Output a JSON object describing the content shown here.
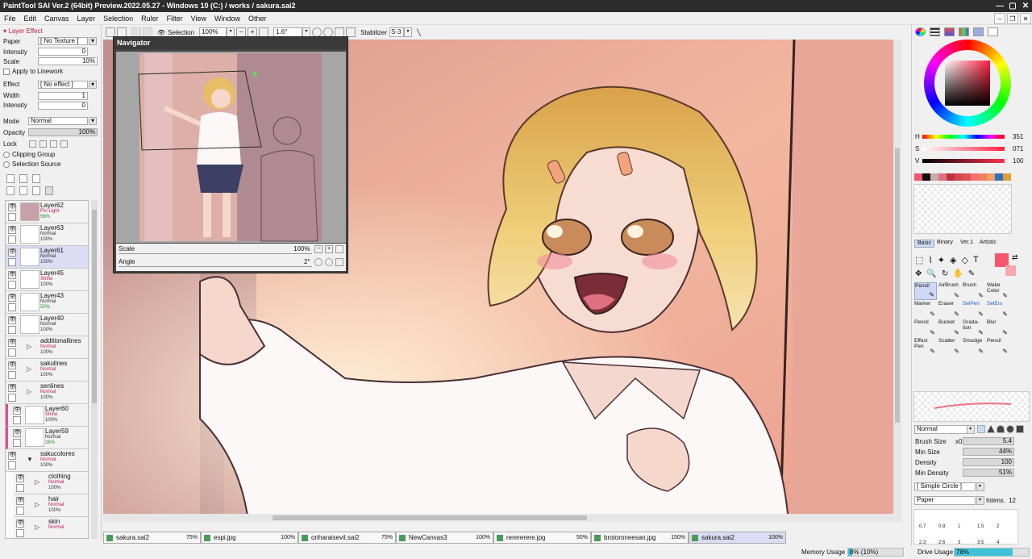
{
  "title_bar": {
    "text": "PaintTool SAI Ver.2 (64bit) Preview.2022.05.27 - Windows 10 (C:) / works / sakura.sai2"
  },
  "menu": [
    "File",
    "Edit",
    "Canvas",
    "Layer",
    "Selection",
    "Ruler",
    "Filter",
    "View",
    "Window",
    "Other"
  ],
  "layer_effect": {
    "header": "Layer Effect",
    "paper_label": "Paper",
    "paper_value": "[ No Texture ]",
    "intensity_label": "Intensity",
    "intensity_value": "0",
    "scale_label": "Scale",
    "scale_value": "10%",
    "apply_linework": "Apply to Linework",
    "effect_label": "Effect",
    "effect_value": "[ No effect ]",
    "width_label": "Width",
    "width_value": "1",
    "intensity2_label": "Intensity",
    "intensity2_value": "0"
  },
  "layer_props": {
    "mode_label": "Mode",
    "mode_value": "Normal",
    "opacity_label": "Opacity",
    "opacity_value": "100%",
    "lock_label": "Lock",
    "clipping_group": "Clipping Group",
    "selection_source": "Selection Source"
  },
  "layers": [
    {
      "name": "Layer62",
      "mode": "Pin Light",
      "opacity": "56%",
      "op_green": true
    },
    {
      "name": "Layer63",
      "mode": "Normal",
      "opacity": "100%"
    },
    {
      "name": "Layer61",
      "mode": "Normal",
      "opacity": "100%",
      "selected": true
    },
    {
      "name": "Layer45",
      "mode": "Shine",
      "opacity": "100%"
    },
    {
      "name": "Layer43",
      "mode": "Normal",
      "opacity": "52%",
      "op_green": true
    },
    {
      "name": "Layer40",
      "mode": "Normal",
      "opacity": "100%"
    },
    {
      "name": "additionallines",
      "mode": "Normal",
      "opacity": "100%",
      "folder": true
    },
    {
      "name": "sakulines",
      "mode": "Normal",
      "opacity": "100%",
      "folder": true
    },
    {
      "name": "senlines",
      "mode": "Normal",
      "opacity": "100%",
      "folder": true
    },
    {
      "name": "Layer60",
      "mode": "Shine",
      "opacity": "100%",
      "clip": true
    },
    {
      "name": "Layer59",
      "mode": "Normal",
      "opacity": "26%",
      "op_green": true,
      "clip": true
    },
    {
      "name": "sakucolores",
      "mode": "Normal",
      "opacity": "100%",
      "folder": true,
      "open": true
    },
    {
      "name": "clothing",
      "mode": "Normal",
      "opacity": "100%",
      "folder": true,
      "indent": true
    },
    {
      "name": "hair",
      "mode": "Normal",
      "opacity": "100%",
      "folder": true,
      "indent": true
    },
    {
      "name": "skin",
      "mode": "Normal",
      "opacity": "",
      "folder": true,
      "indent": true
    }
  ],
  "toolbar": {
    "selection_label": "Selection",
    "zoom": "100%",
    "angle": "1.6°",
    "stabilizer_label": "Stabilizer",
    "stabilizer_value": "S-3"
  },
  "navigator": {
    "title": "Navigator",
    "scale_label": "Scale",
    "scale_value": "100%",
    "angle_label": "Angle",
    "angle_value": "2°"
  },
  "tabs": [
    {
      "name": "sakura.sai2",
      "pct": "75%"
    },
    {
      "name": "espi.jpg",
      "pct": "100%"
    },
    {
      "name": "oriharaisevil.sai2",
      "pct": "75%"
    },
    {
      "name": "NewCanvas3",
      "pct": "100%"
    },
    {
      "name": "rerererere.jpg",
      "pct": "50%"
    },
    {
      "name": "brotoroneesan.jpg",
      "pct": "150%"
    },
    {
      "name": "sakura.sai2",
      "pct": "100%",
      "selected": true
    }
  ],
  "status": {
    "memory_label": "Memory Usage",
    "memory_value": "8% (10%)",
    "memory_fill": 0.08,
    "drive_label": "Drive Usage",
    "drive_value": "78%",
    "drive_fill": 0.78
  },
  "color": {
    "h_label": "H",
    "h_value": "351",
    "s_label": "S",
    "s_value": "071",
    "v_label": "V",
    "v_value": "100",
    "current": "#f7566e",
    "swatches": [
      "#f2566e",
      "#111111",
      "#c8a8a8",
      "#e07080",
      "#c03040",
      "#d04848",
      "#e05050",
      "#f07070",
      "#f08060",
      "#f0a060",
      "#3070c0",
      "#e0a030"
    ]
  },
  "tool_tabs": [
    "Basic",
    "Binary",
    "Ver.1",
    "Artistic"
  ],
  "tools": [
    {
      "label": "Pencil",
      "selected": true
    },
    {
      "label": "AirBrush"
    },
    {
      "label": "Brush"
    },
    {
      "label": "Water Color"
    },
    {
      "label": "Marker"
    },
    {
      "label": "Eraser"
    },
    {
      "label": "SelPen",
      "blue": true
    },
    {
      "label": "SelErs",
      "blue": true
    },
    {
      "label": "Pencil"
    },
    {
      "label": "Bucket"
    },
    {
      "label": "Grada-tion"
    },
    {
      "label": "Blur"
    },
    {
      "label": "Effect Pen"
    },
    {
      "label": "Scatter"
    },
    {
      "label": "Smudge"
    },
    {
      "label": "Pencil"
    }
  ],
  "brush": {
    "mode": "Normal",
    "size_label": "Brush Size",
    "size_mult": "x0.1",
    "size_value": "5.4",
    "min_size_label": "Min Size",
    "min_size_value": "44%",
    "density_label": "Density",
    "density_value": "100",
    "min_density_label": "Min Density",
    "min_density_value": "51%",
    "shape": "[ Simple Circle ]",
    "texture": "Paper",
    "intens_label": "Intens.",
    "intens_value": "12"
  },
  "size_presets": [
    "0.7",
    "0.8",
    "1",
    "1.5",
    "2",
    "2.3",
    "2.6",
    "3",
    "3.5",
    "4"
  ]
}
